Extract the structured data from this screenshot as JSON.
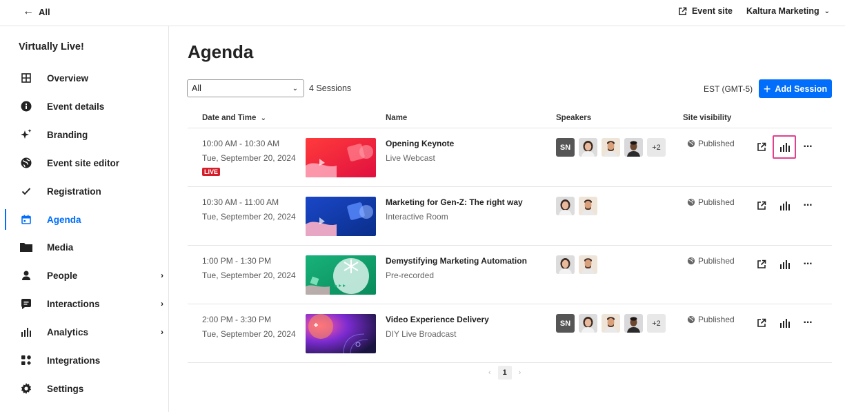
{
  "topbar": {
    "back_label": "All",
    "event_site_label": "Event site",
    "org_label": "Kaltura Marketing"
  },
  "sidebar": {
    "event_title": "Virtually Live!",
    "items": [
      {
        "label": "Overview",
        "icon": "grid-icon"
      },
      {
        "label": "Event details",
        "icon": "info-icon"
      },
      {
        "label": "Branding",
        "icon": "sparkle-icon"
      },
      {
        "label": "Event site editor",
        "icon": "globe-icon"
      },
      {
        "label": "Registration",
        "icon": "check-icon"
      },
      {
        "label": "Agenda",
        "icon": "calendar-icon",
        "active": true
      },
      {
        "label": "Media",
        "icon": "folder-icon"
      },
      {
        "label": "People",
        "icon": "person-icon",
        "has_submenu": true
      },
      {
        "label": "Interactions",
        "icon": "chat-icon",
        "has_submenu": true
      },
      {
        "label": "Analytics",
        "icon": "bar-chart-icon",
        "has_submenu": true
      },
      {
        "label": "Integrations",
        "icon": "puzzle-icon"
      },
      {
        "label": "Settings",
        "icon": "gear-icon"
      }
    ]
  },
  "main": {
    "title": "Agenda",
    "filter_value": "All",
    "session_count": "4 Sessions",
    "timezone": "EST (GMT-5)",
    "add_button_label": "Add Session",
    "columns": {
      "date_time": "Date and Time",
      "name": "Name",
      "speakers": "Speakers",
      "site_visibility": "Site visibility"
    },
    "sessions": [
      {
        "time": "10:00 AM - 10:30 AM",
        "date": "Tue, September 20, 2024",
        "live_badge": "LIVE",
        "name": "Opening Keynote",
        "type": "Live Webcast",
        "speaker_initials": "SN",
        "speaker_more": "+2",
        "visibility": "Published"
      },
      {
        "time": "10:30 AM - 11:00 AM",
        "date": "Tue, September 20, 2024",
        "name": "Marketing for Gen-Z: The right way",
        "type": "Interactive Room",
        "visibility": "Published"
      },
      {
        "time": "1:00 PM - 1:30 PM",
        "date": "Tue, September 20, 2024",
        "name": "Demystifying Marketing Automation",
        "type": "Pre-recorded",
        "visibility": "Published"
      },
      {
        "time": "2:00 PM - 3:30 PM",
        "date": "Tue, September 20, 2024",
        "name": "Video Experience Delivery",
        "type": "DIY Live Broadcast",
        "speaker_initials": "SN",
        "speaker_more": "+2",
        "visibility": "Published"
      }
    ],
    "pagination": {
      "current_page": "1"
    }
  },
  "colors": {
    "accent": "#006efa",
    "live": "#d41e2a",
    "highlight": "#e0418c"
  }
}
